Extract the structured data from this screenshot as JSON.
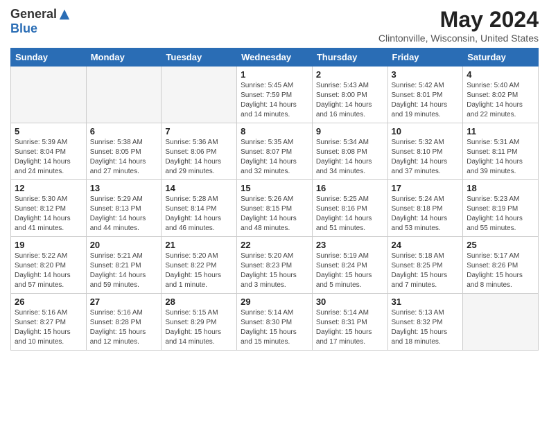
{
  "header": {
    "logo_general": "General",
    "logo_blue": "Blue",
    "month_year": "May 2024",
    "location": "Clintonville, Wisconsin, United States"
  },
  "days_of_week": [
    "Sunday",
    "Monday",
    "Tuesday",
    "Wednesday",
    "Thursday",
    "Friday",
    "Saturday"
  ],
  "weeks": [
    [
      {
        "day": "",
        "info": ""
      },
      {
        "day": "",
        "info": ""
      },
      {
        "day": "",
        "info": ""
      },
      {
        "day": "1",
        "info": "Sunrise: 5:45 AM\nSunset: 7:59 PM\nDaylight: 14 hours\nand 14 minutes."
      },
      {
        "day": "2",
        "info": "Sunrise: 5:43 AM\nSunset: 8:00 PM\nDaylight: 14 hours\nand 16 minutes."
      },
      {
        "day": "3",
        "info": "Sunrise: 5:42 AM\nSunset: 8:01 PM\nDaylight: 14 hours\nand 19 minutes."
      },
      {
        "day": "4",
        "info": "Sunrise: 5:40 AM\nSunset: 8:02 PM\nDaylight: 14 hours\nand 22 minutes."
      }
    ],
    [
      {
        "day": "5",
        "info": "Sunrise: 5:39 AM\nSunset: 8:04 PM\nDaylight: 14 hours\nand 24 minutes."
      },
      {
        "day": "6",
        "info": "Sunrise: 5:38 AM\nSunset: 8:05 PM\nDaylight: 14 hours\nand 27 minutes."
      },
      {
        "day": "7",
        "info": "Sunrise: 5:36 AM\nSunset: 8:06 PM\nDaylight: 14 hours\nand 29 minutes."
      },
      {
        "day": "8",
        "info": "Sunrise: 5:35 AM\nSunset: 8:07 PM\nDaylight: 14 hours\nand 32 minutes."
      },
      {
        "day": "9",
        "info": "Sunrise: 5:34 AM\nSunset: 8:08 PM\nDaylight: 14 hours\nand 34 minutes."
      },
      {
        "day": "10",
        "info": "Sunrise: 5:32 AM\nSunset: 8:10 PM\nDaylight: 14 hours\nand 37 minutes."
      },
      {
        "day": "11",
        "info": "Sunrise: 5:31 AM\nSunset: 8:11 PM\nDaylight: 14 hours\nand 39 minutes."
      }
    ],
    [
      {
        "day": "12",
        "info": "Sunrise: 5:30 AM\nSunset: 8:12 PM\nDaylight: 14 hours\nand 41 minutes."
      },
      {
        "day": "13",
        "info": "Sunrise: 5:29 AM\nSunset: 8:13 PM\nDaylight: 14 hours\nand 44 minutes."
      },
      {
        "day": "14",
        "info": "Sunrise: 5:28 AM\nSunset: 8:14 PM\nDaylight: 14 hours\nand 46 minutes."
      },
      {
        "day": "15",
        "info": "Sunrise: 5:26 AM\nSunset: 8:15 PM\nDaylight: 14 hours\nand 48 minutes."
      },
      {
        "day": "16",
        "info": "Sunrise: 5:25 AM\nSunset: 8:16 PM\nDaylight: 14 hours\nand 51 minutes."
      },
      {
        "day": "17",
        "info": "Sunrise: 5:24 AM\nSunset: 8:18 PM\nDaylight: 14 hours\nand 53 minutes."
      },
      {
        "day": "18",
        "info": "Sunrise: 5:23 AM\nSunset: 8:19 PM\nDaylight: 14 hours\nand 55 minutes."
      }
    ],
    [
      {
        "day": "19",
        "info": "Sunrise: 5:22 AM\nSunset: 8:20 PM\nDaylight: 14 hours\nand 57 minutes."
      },
      {
        "day": "20",
        "info": "Sunrise: 5:21 AM\nSunset: 8:21 PM\nDaylight: 14 hours\nand 59 minutes."
      },
      {
        "day": "21",
        "info": "Sunrise: 5:20 AM\nSunset: 8:22 PM\nDaylight: 15 hours\nand 1 minute."
      },
      {
        "day": "22",
        "info": "Sunrise: 5:20 AM\nSunset: 8:23 PM\nDaylight: 15 hours\nand 3 minutes."
      },
      {
        "day": "23",
        "info": "Sunrise: 5:19 AM\nSunset: 8:24 PM\nDaylight: 15 hours\nand 5 minutes."
      },
      {
        "day": "24",
        "info": "Sunrise: 5:18 AM\nSunset: 8:25 PM\nDaylight: 15 hours\nand 7 minutes."
      },
      {
        "day": "25",
        "info": "Sunrise: 5:17 AM\nSunset: 8:26 PM\nDaylight: 15 hours\nand 8 minutes."
      }
    ],
    [
      {
        "day": "26",
        "info": "Sunrise: 5:16 AM\nSunset: 8:27 PM\nDaylight: 15 hours\nand 10 minutes."
      },
      {
        "day": "27",
        "info": "Sunrise: 5:16 AM\nSunset: 8:28 PM\nDaylight: 15 hours\nand 12 minutes."
      },
      {
        "day": "28",
        "info": "Sunrise: 5:15 AM\nSunset: 8:29 PM\nDaylight: 15 hours\nand 14 minutes."
      },
      {
        "day": "29",
        "info": "Sunrise: 5:14 AM\nSunset: 8:30 PM\nDaylight: 15 hours\nand 15 minutes."
      },
      {
        "day": "30",
        "info": "Sunrise: 5:14 AM\nSunset: 8:31 PM\nDaylight: 15 hours\nand 17 minutes."
      },
      {
        "day": "31",
        "info": "Sunrise: 5:13 AM\nSunset: 8:32 PM\nDaylight: 15 hours\nand 18 minutes."
      },
      {
        "day": "",
        "info": ""
      }
    ]
  ]
}
